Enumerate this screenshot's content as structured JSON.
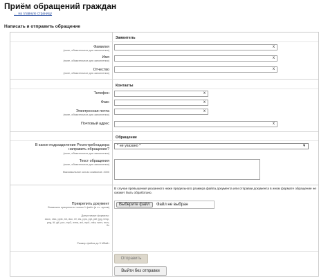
{
  "page_title": "Приём обращений граждан",
  "back_link": "← на главную страницу",
  "section_title": "Написать и отправить обращение",
  "hint_required": "(поле, обязательное для заполнения)",
  "clear_glyph": "x",
  "groups": {
    "applicant": "Заявитель",
    "contacts": "Контакты",
    "appeal": "Обращение"
  },
  "fields": {
    "surname": "Фамилия",
    "name": "Имя",
    "patronymic": "Отчество",
    "phone": "Телефон",
    "fax": "Факс",
    "email": "Электронная почта",
    "postal": "Почтовый адрес"
  },
  "department": {
    "label": "В какое подразделение Роспотребнадзора направить обращение?",
    "value": "* не указано *"
  },
  "appeal_text": {
    "label": "Текст обращения",
    "max_chars": "Максимальное кол-во символов: 2000"
  },
  "attach": {
    "label": "Прикрепить документ",
    "only_one": "Возможно прикрепить только 1 файл (в т.ч. архив)",
    "formats_title": "Допустимые форматы:",
    "formats": "docx, xlsx, pptx, txt, doc, rtf, xls, pps, ppt, pdf, jpg, bmp, png, tif, gif, pcx, mp3, wma, avi, mp4, mkv, wmv, mov, flv",
    "size": "Размер файла до 5 Мбайт",
    "info": "В случае превышения указанного ниже предельного размера файла документа или отправки документа в ином формате обращение не сможет быть обработано.",
    "choose_button": "Выберите файл",
    "no_file": "Файл не выбран"
  },
  "buttons": {
    "submit": "Отправить",
    "exit": "Выйти без отправки"
  }
}
